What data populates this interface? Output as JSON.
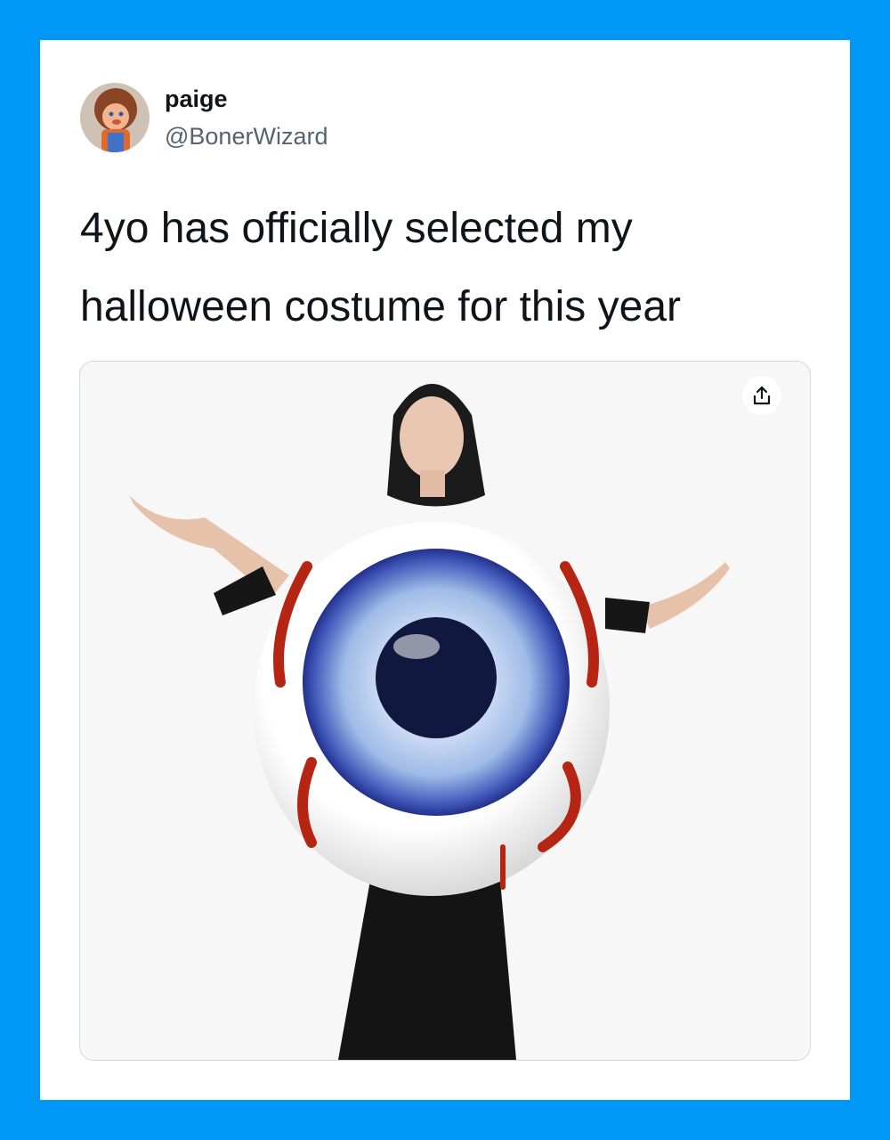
{
  "user": {
    "display_name": "paige",
    "handle": "@BonerWizard",
    "avatar_icon": "avatar-icon"
  },
  "tweet": {
    "text": "4yo has officially selected my halloween costume for this year"
  },
  "media": {
    "share_icon": "share-icon"
  },
  "colors": {
    "frame": "#0098f7",
    "card": "#ffffff",
    "text": "#0f1419",
    "muted": "#536471",
    "iris": "#2c3fa0"
  }
}
